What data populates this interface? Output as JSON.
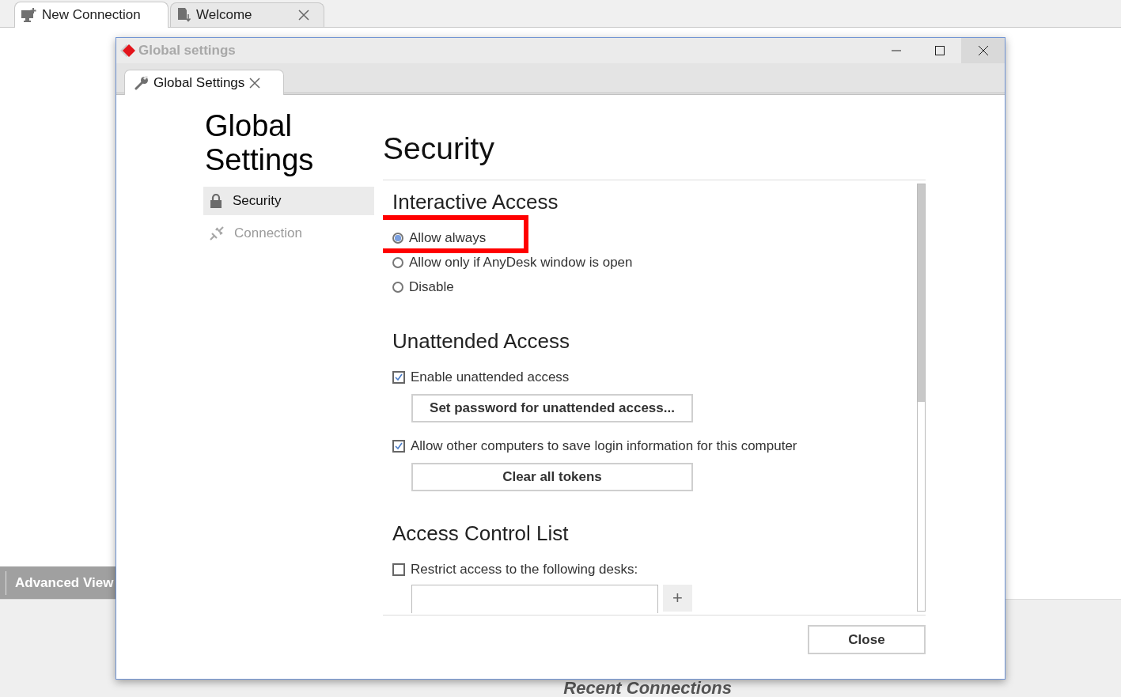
{
  "app_tabs": [
    {
      "label": "New Connection",
      "selected": true,
      "closable": false
    },
    {
      "label": "Welcome",
      "selected": false,
      "closable": true
    }
  ],
  "advanced_view": {
    "label": "Advanced View"
  },
  "recent_heading": "Recent Connections",
  "dialog": {
    "title": "Global settings",
    "tab": {
      "label": "Global Settings"
    },
    "heading": "Global Settings",
    "nav": [
      {
        "label": "Security",
        "selected": true
      },
      {
        "label": "Connection",
        "selected": false
      }
    ],
    "page_title": "Security",
    "sections": [
      {
        "title": "Interactive Access",
        "items": [
          {
            "kind": "radio",
            "label": "Allow always",
            "selected": true,
            "highlighted": true
          },
          {
            "kind": "radio",
            "label": "Allow only if AnyDesk window is open",
            "selected": false
          },
          {
            "kind": "radio",
            "label": "Disable",
            "selected": false
          }
        ]
      },
      {
        "title": "Unattended Access",
        "items": [
          {
            "kind": "checkbox",
            "label": "Enable unattended access",
            "checked": true
          },
          {
            "kind": "button",
            "label": "Set password for unattended access..."
          },
          {
            "kind": "checkbox",
            "label": "Allow other computers to save login information for this computer",
            "checked": true
          },
          {
            "kind": "button",
            "label": "Clear all tokens"
          }
        ]
      },
      {
        "title": "Access Control List",
        "items": [
          {
            "kind": "checkbox",
            "label": "Restrict access to the following desks:",
            "checked": false
          },
          {
            "kind": "entry",
            "add": "+"
          }
        ]
      }
    ],
    "close_button": "Close"
  }
}
